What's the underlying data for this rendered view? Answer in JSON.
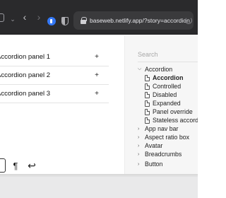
{
  "browser": {
    "url": "baseweb.netlify.app/?story=accordion"
  },
  "main": {
    "panels": [
      {
        "title": "Accordion panel 1"
      },
      {
        "title": "Accordion panel 2"
      },
      {
        "title": "Accordion panel 3"
      }
    ],
    "expand_glyph": "+"
  },
  "sidebar": {
    "search_placeholder": "Search",
    "tree": [
      {
        "label": "Accordion",
        "expanded": true,
        "children": [
          "Accordion",
          "Controlled",
          "Disabled",
          "Expanded",
          "Panel override",
          "Stateless accordion"
        ]
      },
      {
        "label": "App nav bar"
      },
      {
        "label": "Aspect ratio box"
      },
      {
        "label": "Avatar"
      },
      {
        "label": "Breadcrumbs"
      },
      {
        "label": "Button"
      }
    ],
    "active_story": "Accordion"
  },
  "icons": [
    "sidebar-toggle-icon",
    "chevron-down-icon",
    "back-arrow-icon",
    "forward-arrow-icon",
    "extension-icon",
    "shield-icon",
    "lock-icon",
    "reload-icon",
    "plus-icon",
    "pilcrow-icon",
    "undo-icon",
    "document-icon",
    "chevron-right-icon"
  ]
}
